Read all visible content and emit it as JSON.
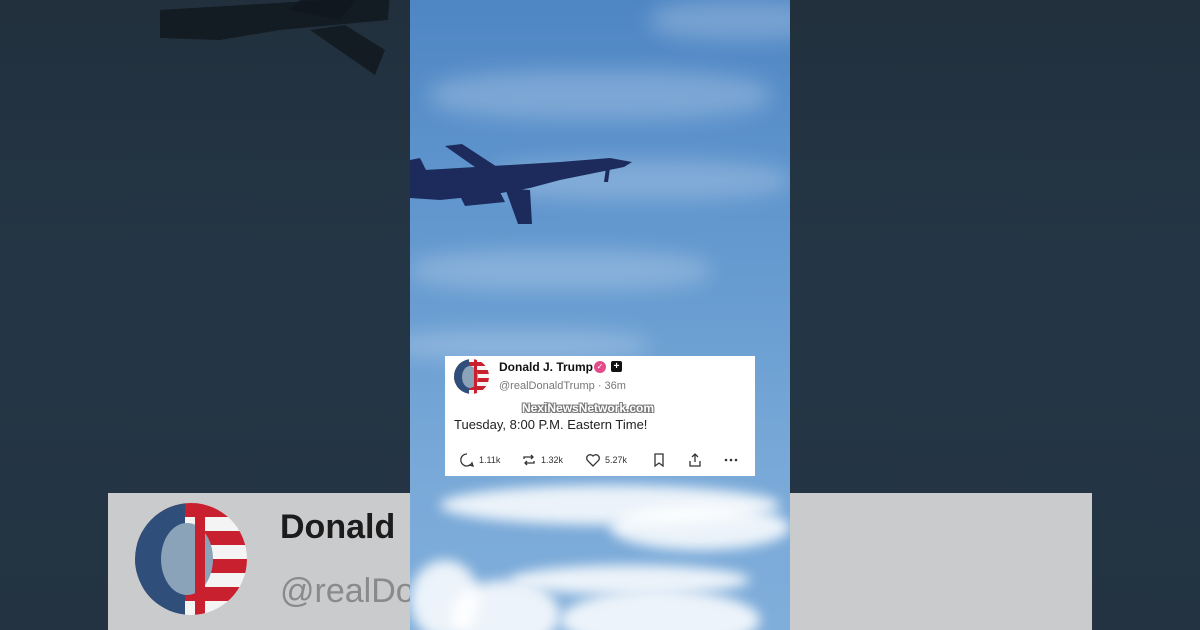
{
  "post": {
    "author_name": "Donald J. Trump",
    "handle": "@realDonaldTrump",
    "separator": "·",
    "time_ago": "36m",
    "text": "Tuesday, 8:00 P.M. Eastern Time!",
    "watermark": "NexiNewsNetwork.com",
    "verified_icon": "check-badge-icon",
    "plus_badge": "+",
    "actions": {
      "reply_count": "1.11k",
      "retruth_count": "1.32k",
      "like_count": "5.27k"
    }
  },
  "background": {
    "name_fragment": "Donald",
    "handle_fragment": "@realDo"
  },
  "colors": {
    "sky_top": "#4e86c4",
    "sky_bottom": "#80aedb",
    "verified": "#e44b8a",
    "card": "#ffffff"
  }
}
